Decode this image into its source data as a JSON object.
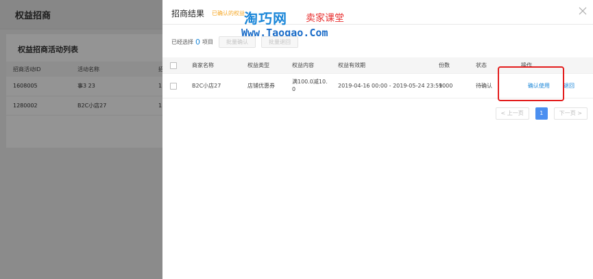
{
  "background": {
    "header_title": "权益招商",
    "panel_title": "权益招商活动列表",
    "columns": [
      "招商活动ID",
      "活动名称",
      "招"
    ],
    "rows": [
      [
        "1608005",
        "事3 23",
        "1"
      ],
      [
        "1280002",
        "B2C小店27",
        "1"
      ]
    ]
  },
  "drawer": {
    "title": "招商结果",
    "note": "已确认的权益",
    "close_icon": "close-icon"
  },
  "watermark": {
    "brand": "淘巧网",
    "sub": "卖家课堂",
    "url": "Www.Taoqao.Com"
  },
  "toolbar": {
    "selected_prefix": "已经选择",
    "selected_count": "0",
    "selected_suffix": "项目",
    "batch_confirm": "批量确认",
    "batch_return": "批量退回"
  },
  "table": {
    "headers": {
      "merchant": "商家名称",
      "type": "权益类型",
      "content": "权益内容",
      "period": "权益有效期",
      "count": "份数",
      "status": "状态",
      "action": "操作"
    },
    "rows": [
      {
        "merchant": "B2C小店27",
        "type": "店铺优惠券",
        "content_l1": "满100.0减10.",
        "content_l2": "0",
        "period": "2019-04-16 00:00 - 2019-05-24 23:59",
        "count": "1000",
        "status": "待确认",
        "action_confirm": "确认使用",
        "action_return": "退回"
      }
    ]
  },
  "pager": {
    "prev": "< 上一页",
    "current": "1",
    "next": "下一页 >"
  },
  "colors": {
    "accent": "#1a86d8",
    "highlight_box": "#e31c1c",
    "note": "#f5a623",
    "pager_active": "#4b8ff0"
  }
}
